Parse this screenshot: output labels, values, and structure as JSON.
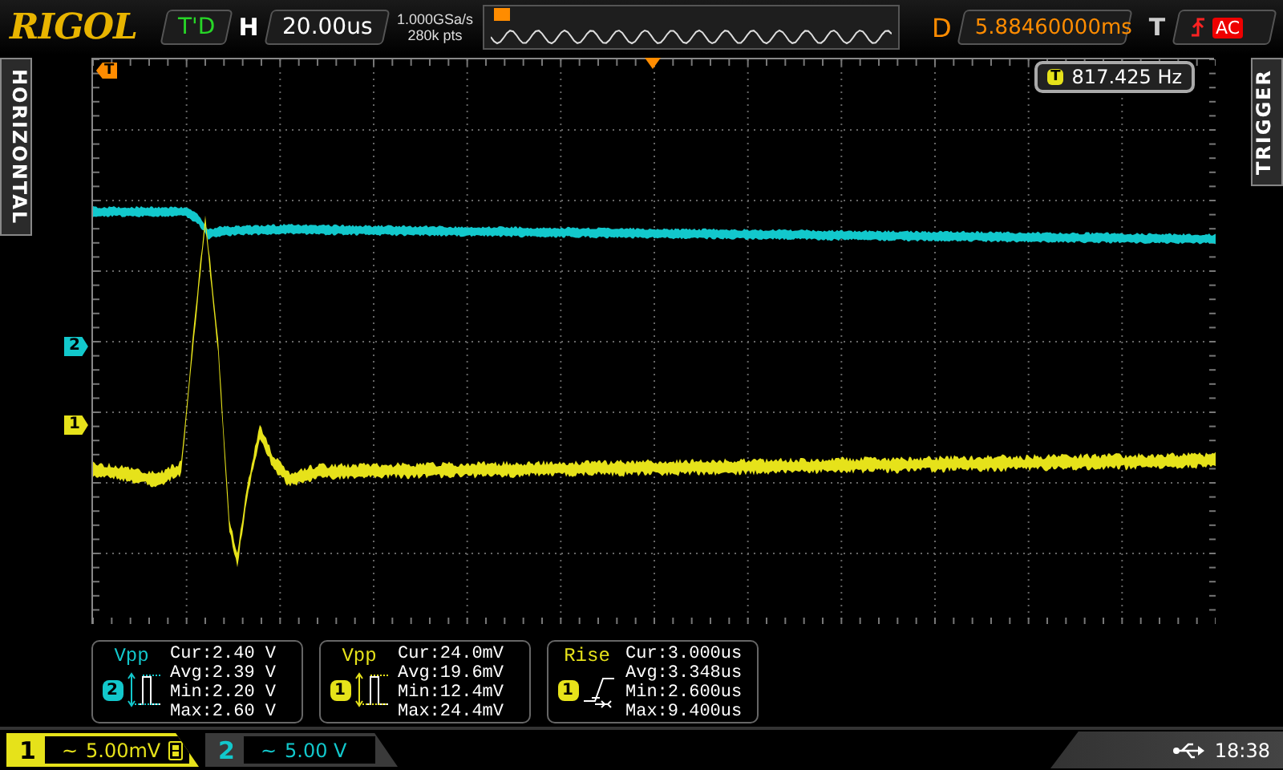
{
  "top_bar": {
    "logo": "RIGOL",
    "run_status": "T'D",
    "timebase_label": "H",
    "timebase": "20.00us",
    "sample_rate": "1.000GSa/s",
    "memory_depth": "280k pts",
    "delay_label": "D",
    "delay": "5.88460000ms",
    "trigger_label": "T",
    "trigger_coupling": "AC"
  },
  "side_tabs": {
    "left": "HORIZONTAL",
    "right": "TRIGGER"
  },
  "plot": {
    "trigger_marker": "T",
    "frequency_badge": "T",
    "frequency": "817.425 Hz",
    "traces": [
      {
        "label": "2",
        "color": "#12c8cc"
      },
      {
        "label": "1",
        "color": "#e6e21a"
      }
    ]
  },
  "measurements": [
    {
      "kind": "vpp",
      "name": "Vpp",
      "source": "2",
      "color": "#12c8cc",
      "lines": [
        "Cur:2.40 V",
        "Avg:2.39 V",
        "Min:2.20 V",
        "Max:2.60 V"
      ]
    },
    {
      "kind": "vpp",
      "name": "Vpp",
      "source": "1",
      "color": "#e6e21a",
      "lines": [
        "Cur:24.0mV",
        "Avg:19.6mV",
        "Min:12.4mV",
        "Max:24.4mV"
      ]
    },
    {
      "kind": "rise",
      "name": "Rise",
      "source": "1",
      "color": "#e6e21a",
      "lines": [
        "Cur:3.000us",
        "Avg:3.348us",
        "Min:2.600us",
        "Max:9.400us"
      ]
    }
  ],
  "channels": [
    {
      "label": "1",
      "coupling": "~",
      "scale": "5.00mV",
      "selected": true,
      "bandwidth_limit": true,
      "color": "#e6e21a"
    },
    {
      "label": "2",
      "coupling": "~",
      "scale": "5.00 V",
      "selected": false,
      "bandwidth_limit": false,
      "color": "#12c8cc"
    }
  ],
  "status": {
    "time": "18:38"
  }
}
